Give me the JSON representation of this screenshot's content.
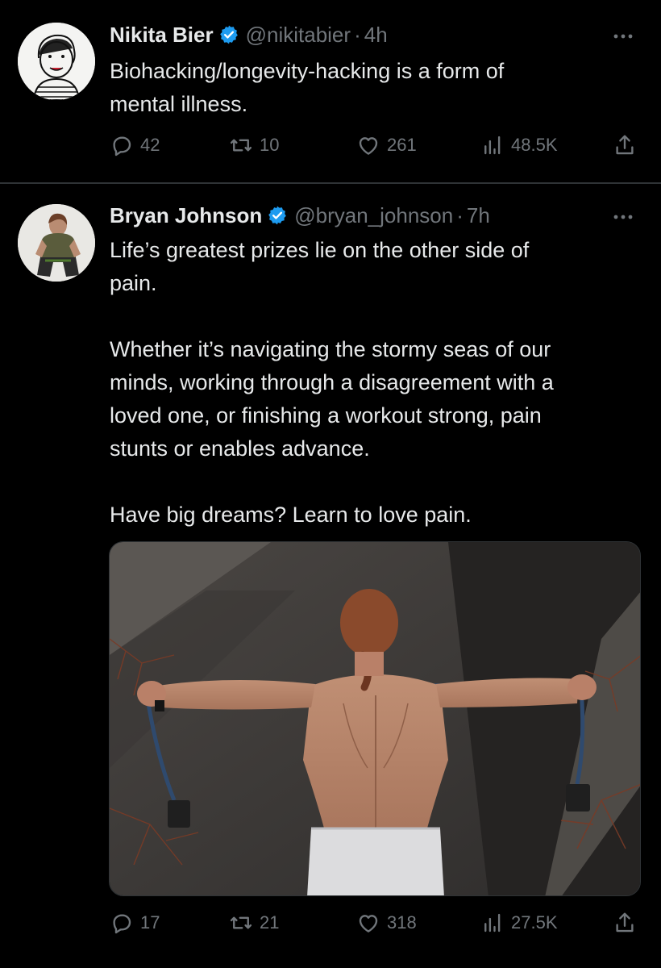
{
  "tweets": [
    {
      "name": "Nikita Bier",
      "handle": "@nikitabier",
      "separator": "·",
      "time": "4h",
      "text": "Biohacking/longevity-hacking is a form of\nmental illness.",
      "replies": "42",
      "retweets": "10",
      "likes": "261",
      "views": "48.5K"
    },
    {
      "name": "Bryan Johnson",
      "handle": "@bryan_johnson",
      "separator": "·",
      "time": "7h",
      "text": "Life’s greatest prizes lie on the other side of\npain.\n\nWhether it’s navigating the stormy seas of our\nminds, working through a disagreement with a\nloved one, or finishing a workout strong, pain\nstunts or enables advance.\n\nHave big dreams? Learn to love pain.",
      "replies": "17",
      "retweets": "21",
      "likes": "318",
      "views": "27.5K"
    }
  ],
  "colors": {
    "background": "#000000",
    "primary_text": "#e7e9ea",
    "secondary_text": "#71767b",
    "verified": "#1d9bf0",
    "divider": "#2f3336"
  },
  "icons": [
    "reply-icon",
    "retweet-icon",
    "like-icon",
    "views-icon",
    "share-icon",
    "more-icon",
    "verified-badge-icon"
  ]
}
